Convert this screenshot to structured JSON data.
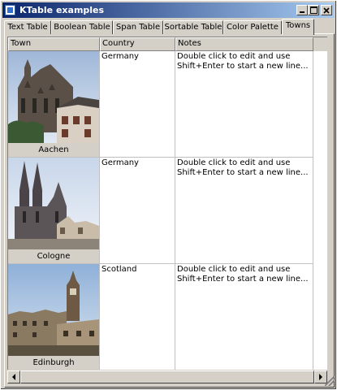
{
  "window": {
    "title": "KTable examples",
    "minimize_label": "_",
    "maximize_label": "□",
    "close_label": "✕"
  },
  "tabs": [
    {
      "label": "Text Table"
    },
    {
      "label": "Boolean Table"
    },
    {
      "label": "Span Table"
    },
    {
      "label": "Sortable Table"
    },
    {
      "label": "Color Palette"
    },
    {
      "label": "Towns"
    }
  ],
  "active_tab": "Towns",
  "table": {
    "columns": [
      "Town",
      "Country",
      "Notes"
    ],
    "rows": [
      {
        "town": "Aachen",
        "country": "Germany",
        "notes": "Double click to edit and use Shift+Enter to start a new line...",
        "photo": "aachen-cathedral"
      },
      {
        "town": "Cologne",
        "country": "Germany",
        "notes": "Double click to edit and use Shift+Enter to start a new line...",
        "photo": "cologne-cathedral"
      },
      {
        "town": "Edinburgh",
        "country": "Scotland",
        "notes": "Double click to edit and use Shift+Enter to start a new line...",
        "photo": "edinburgh-skyline"
      }
    ]
  },
  "colors": {
    "title_start": "#0a246a",
    "title_end": "#a6caf0",
    "chrome": "#d4d0c8",
    "grid_line": "#c0c0c0"
  }
}
